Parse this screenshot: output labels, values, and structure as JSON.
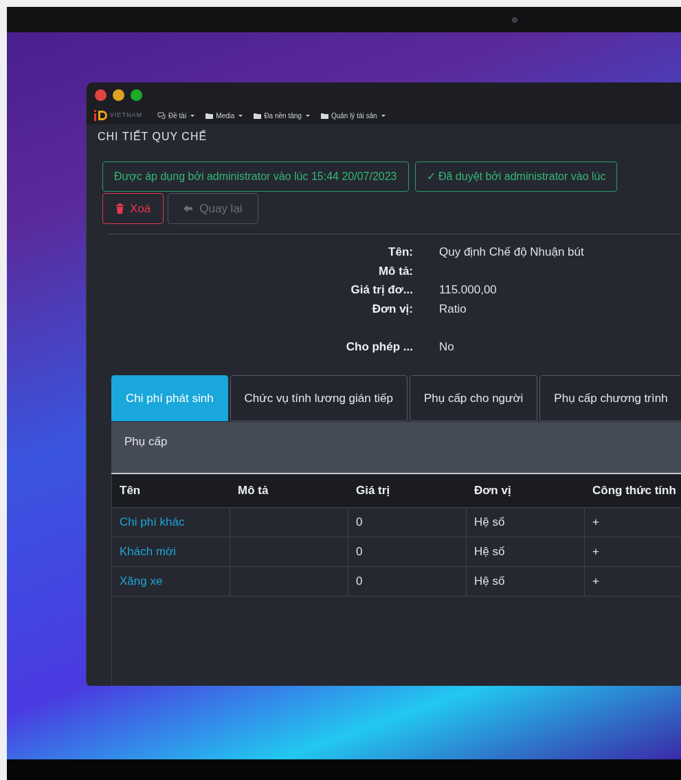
{
  "window": {
    "traffic_lights": [
      {
        "color": "#e0443e"
      },
      {
        "color": "#dea123"
      },
      {
        "color": "#1aab29"
      }
    ]
  },
  "logo": {
    "text": "VIETNAM"
  },
  "menu": [
    {
      "label": "Đề tài",
      "kind": "chat"
    },
    {
      "label": "Media",
      "kind": "folder"
    },
    {
      "label": "Đa nền tảng",
      "kind": "folder"
    },
    {
      "label": "Quản lý tài sản",
      "kind": "folder"
    }
  ],
  "page_title": "CHI TIẾT QUY CHẾ",
  "status_badges": [
    {
      "text": "Được áp dụng bởi administrator vào lúc 15:44 20/07/2023"
    },
    {
      "text": "✓ Đã duyệt bởi administrator vào lúc"
    }
  ],
  "actions": [
    {
      "label": "Xoá",
      "kind": "danger"
    },
    {
      "label": "Quay lại",
      "kind": "back"
    }
  ],
  "fields": [
    {
      "kind": "pair",
      "label": "Tên:",
      "value": "Quy định Chế độ Nhuận bút"
    },
    {
      "kind": "pair",
      "label": "Mô tả:"
    },
    {
      "kind": "pair",
      "label": "Giá trị đơ...",
      "value": "115.000,00"
    },
    {
      "kind": "pair",
      "label": "Đơn vị:",
      "value": "Ratio"
    },
    {
      "kind": "spacer"
    },
    {
      "kind": "pair",
      "label": "Cho phép ...",
      "value": "No"
    }
  ],
  "tabs": [
    {
      "label": "Chi phí phát sinh",
      "selected": true
    },
    {
      "label": "Chức vụ tính lương gián tiếp",
      "selected": false
    },
    {
      "label": "Phụ cấp cho người",
      "selected": false
    },
    {
      "label": "Phụ cấp chương trình",
      "selected": false
    }
  ],
  "panel_title": "Phụ cấp",
  "table": {
    "columns": [
      "Tên",
      "Mô tả",
      "Giá trị",
      "Đơn vị",
      "Công thức tính"
    ],
    "rows": [
      [
        "Chi phí khác",
        "",
        "0",
        "Hệ số",
        "+"
      ],
      [
        "Khách mời",
        "",
        "0",
        "Hệ số",
        "+"
      ],
      [
        "Xăng xe",
        "",
        "0",
        "Hệ số",
        "+"
      ]
    ]
  }
}
